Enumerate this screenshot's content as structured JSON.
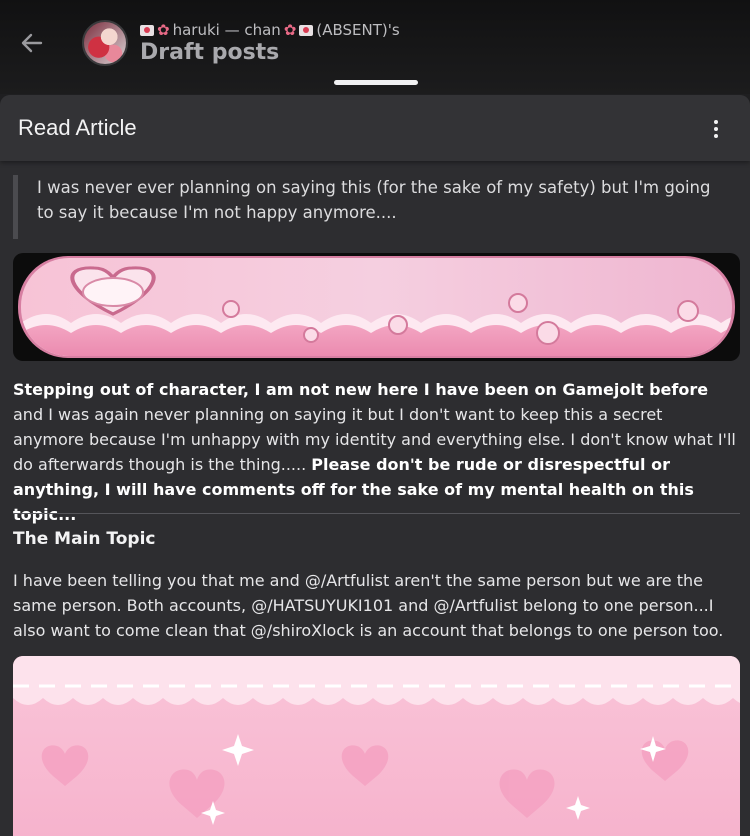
{
  "header": {
    "owner_name": "haruki — chan",
    "owner_suffix": "(ABSENT)'s",
    "title": "Draft posts"
  },
  "sheet": {
    "title": "Read Article"
  },
  "article": {
    "quote": "I was never ever planning on saying this (for the sake of my safety) but I'm going to say it because I'm not happy anymore....",
    "p1_bold_a": "Stepping out of character, I am not new here I have been on Gamejolt before",
    "p1_text": " and I was again never planning on saying it but I don't want to keep this a secret anymore because I'm unhappy with my identity and everything else. I don't know what I'll do afterwards though is the thing..... ",
    "p1_bold_b": "Please don't be rude or disrespectful or anything, I will have comments off for the sake of my mental health on this topic...",
    "heading": "The Main Topic",
    "p2": "I have been telling you that me and @/Artfulist aren't the same person but we are the same person. Both accounts, @/HATSUYUKI101 and @/Artfulist belong to one person...I also want to come clean that @/shiroXlock is an account that belongs to one person too."
  },
  "colors": {
    "accent_pink": "#f3a7c6",
    "background": "#1f1f21",
    "sheet": "#2d2d30"
  },
  "icons": [
    "back-arrow-icon",
    "kebab-menu-icon",
    "envelope-heart-icon",
    "flower-icon"
  ]
}
